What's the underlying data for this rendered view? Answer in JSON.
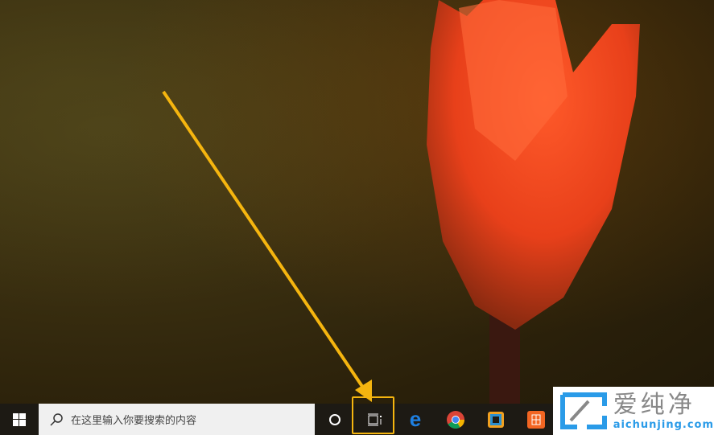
{
  "taskbar": {
    "search_placeholder": "在这里输入你要搜索的内容",
    "icons": [
      "windows-start-icon",
      "search-icon",
      "cortana-icon",
      "task-view-icon",
      "edge-icon",
      "chrome-icon",
      "app-icon",
      "orange-app-icon"
    ]
  },
  "watermark": {
    "cn": "爱纯净",
    "en": "aichunjing.com"
  },
  "colors": {
    "highlight": "#f5b50f",
    "taskbar": "#1d1a14",
    "tulip": "#e8401a"
  }
}
